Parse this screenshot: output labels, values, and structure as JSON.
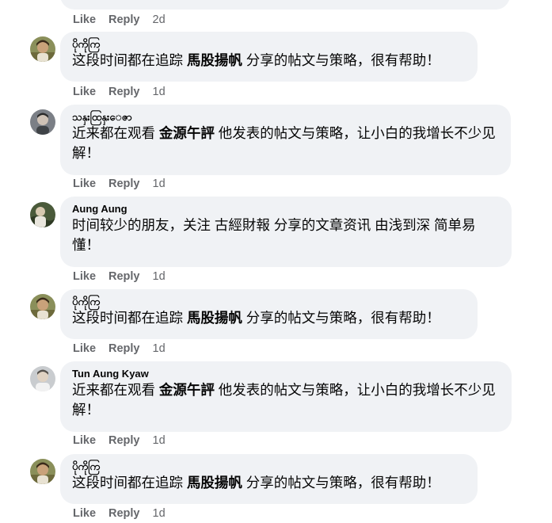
{
  "top_actions": {
    "like": "Like",
    "reply": "Reply",
    "time": "2d"
  },
  "comments": [
    {
      "author": "ပိုကိုကြ",
      "text_before": "这段时间都在追踪 ",
      "highlight": "馬股揚帆",
      "text_after": " 分享的帖文与策略，很有帮助！",
      "like": "Like",
      "reply": "Reply",
      "time": "1d"
    },
    {
      "author": "သနှးထြနှးေဇာ",
      "text_before": "近来都在观看 ",
      "highlight": "金源午評",
      "text_after": " 他发表的帖文与策略，让小白的我增长不少见解！",
      "like": "Like",
      "reply": "Reply",
      "time": "1d"
    },
    {
      "author": "Aung Aung",
      "text_before": "时间较少的朋友，关注 古經財報 分享的文章资讯 由浅到深 简单易懂！",
      "highlight": "",
      "text_after": "",
      "like": "Like",
      "reply": "Reply",
      "time": "1d"
    },
    {
      "author": "ပိုကိုကြ",
      "text_before": "这段时间都在追踪 ",
      "highlight": "馬股揚帆",
      "text_after": " 分享的帖文与策略，很有帮助！",
      "like": "Like",
      "reply": "Reply",
      "time": "1d"
    },
    {
      "author": "Tun Aung Kyaw",
      "text_before": "近来都在观看 ",
      "highlight": "金源午評",
      "text_after": " 他发表的帖文与策略，让小白的我增长不少见解！",
      "like": "Like",
      "reply": "Reply",
      "time": "1d"
    },
    {
      "author": "ပိုကိုကြ",
      "text_before": "这段时间都在追踪 ",
      "highlight": "馬股揚帆",
      "text_after": " 分享的帖文与策略，很有帮助！",
      "like": "Like",
      "reply": "Reply",
      "time": "1d"
    }
  ]
}
